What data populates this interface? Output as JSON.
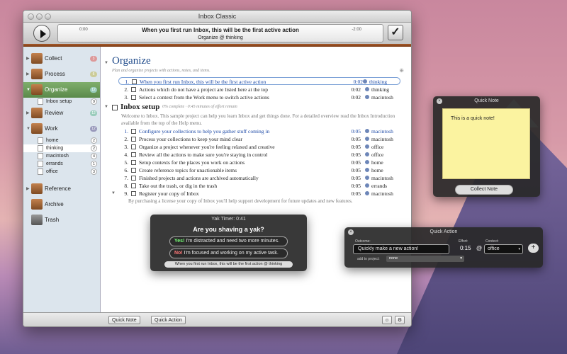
{
  "window": {
    "title": "Inbox Classic"
  },
  "player": {
    "task": "When you first run Inbox, this will be the first active action",
    "sub": "Organize @ thinking",
    "time_left": "0:00",
    "time_right": "-2:00"
  },
  "sidebar": {
    "items": [
      {
        "label": "Collect",
        "badge": "3"
      },
      {
        "label": "Process",
        "badge": "6"
      },
      {
        "label": "Organize",
        "badge": "12"
      },
      {
        "label": "Review",
        "badge": "12"
      },
      {
        "label": "Work",
        "badge": "12"
      },
      {
        "label": "Reference"
      },
      {
        "label": "Archive"
      },
      {
        "label": "Trash"
      }
    ],
    "organize_sub": [
      {
        "label": "Inbox setup",
        "badge": "9"
      }
    ],
    "work_sub": [
      {
        "label": "home",
        "badge": "2"
      },
      {
        "label": "thinking",
        "badge": "2"
      },
      {
        "label": "macintosh",
        "badge": "4"
      },
      {
        "label": "errands",
        "badge": "1"
      },
      {
        "label": "office",
        "badge": "3"
      }
    ]
  },
  "main": {
    "title": "Organize",
    "subtitle": "Plan and organize projects with actions, notes, and items.",
    "rows1": [
      {
        "n": "1.",
        "text": "When you first run Inbox, this will be the first active action",
        "dur": "0:02",
        "ctx": "thinking"
      },
      {
        "n": "2.",
        "text": "Actions which do not have a project are listed here at the top",
        "dur": "0:02",
        "ctx": "thinking"
      },
      {
        "n": "3.",
        "text": "Select a context from the Work menu to switch active actions",
        "dur": "0:02",
        "ctx": "macintosh"
      }
    ],
    "project": {
      "title": "Inbox setup",
      "meta": "0% complete · 0:45 minutes of effort remain",
      "note": "Welcome to Inbox. This sample project can help you learn Inbox and get things done. For a detailed overview read the Inbox Introduction available from the top of the Help menu."
    },
    "rows2": [
      {
        "n": "1.",
        "text": "Configure your collections to help you gather stuff coming in",
        "dur": "0:05",
        "ctx": "macintosh"
      },
      {
        "n": "2.",
        "text": "Process your collections to keep your mind clear",
        "dur": "0:05",
        "ctx": "macintosh"
      },
      {
        "n": "3.",
        "text": "Organize a project whenever you're feeling relaxed and creative",
        "dur": "0:05",
        "ctx": "office"
      },
      {
        "n": "4.",
        "text": "Review all the actions to make sure you're staying in control",
        "dur": "0:05",
        "ctx": "office"
      },
      {
        "n": "5.",
        "text": "Setup contexts for the places you work on actions",
        "dur": "0:05",
        "ctx": "home"
      },
      {
        "n": "6.",
        "text": "Create reference topics for unactionable items",
        "dur": "0:05",
        "ctx": "home"
      },
      {
        "n": "7.",
        "text": "Finished projects and actions are archived automatically",
        "dur": "0:05",
        "ctx": "macintosh"
      },
      {
        "n": "8.",
        "text": "Take out the trash, or dig in the trash",
        "dur": "0:05",
        "ctx": "errands"
      },
      {
        "n": "9.",
        "text": "Register your copy of Inbox",
        "dur": "0:05",
        "ctx": "macintosh"
      }
    ],
    "footer_note": "By purchasing a license your copy of Inbox you'll help support development for future updates and new features."
  },
  "statusbar": {
    "quick_note": "Quick Note",
    "quick_action": "Quick Action"
  },
  "yak": {
    "title": "Yak Timer: 0:41",
    "question": "Are you shaving a yak?",
    "yes_tag": "Yes!",
    "yes": "I'm distracted and need two more minutes.",
    "no_tag": "No!",
    "no": "I'm focused and working on my active task.",
    "task": "When you first run Inbox, this will be the first action @ thinking"
  },
  "quicknote": {
    "title": "Quick Note",
    "text": "This is a quick note!",
    "button": "Collect Note"
  },
  "quickaction": {
    "title": "Quick Action",
    "outcome_label": "Outcome:",
    "outcome": "Quickly make a new action!",
    "effort_label": "Effort:",
    "effort": "0:15",
    "at": "@",
    "context_label": "Context:",
    "context": "office",
    "project_label": "add to project:",
    "project": "none"
  }
}
